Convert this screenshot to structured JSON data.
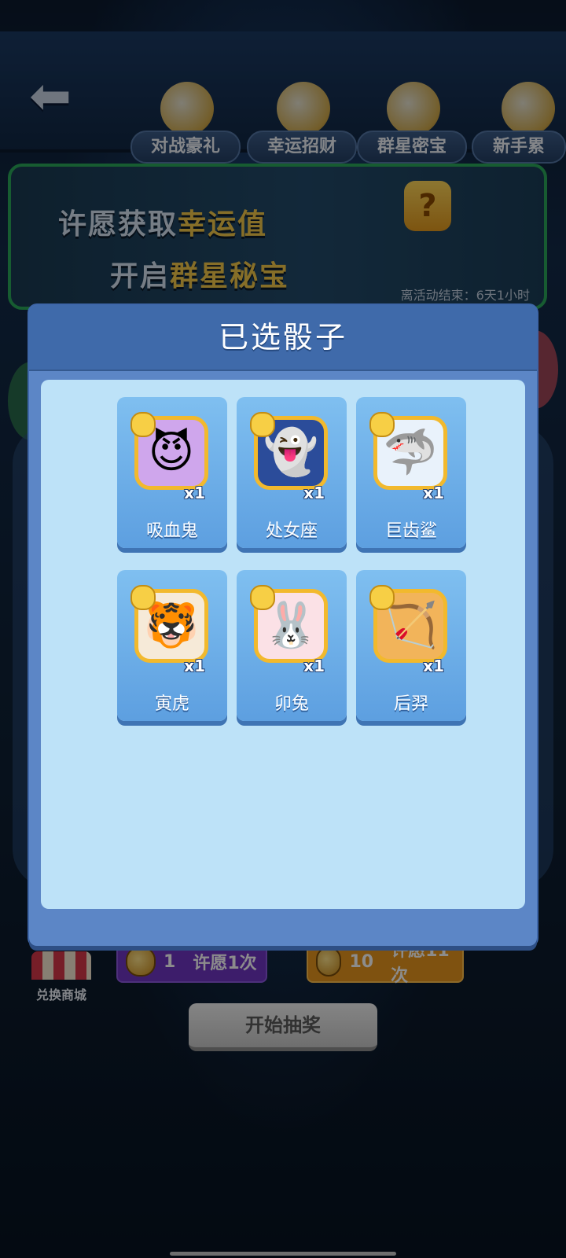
{
  "top_nav": {
    "tabs": [
      {
        "label": "对战豪礼"
      },
      {
        "label": "幸运招财"
      },
      {
        "label": "群星密宝"
      },
      {
        "label": "新手累"
      }
    ]
  },
  "banner": {
    "line1_prefix": "许愿获取",
    "line1_highlight": "幸运值",
    "line2_prefix": "开启",
    "line2_highlight": "群星秘宝",
    "timer": "离活动结束：6天1小时"
  },
  "bottom": {
    "shop_label": "兑换商城",
    "wish_once": {
      "cost": "1",
      "label": "许愿1次"
    },
    "wish_ten": {
      "cost": "10",
      "label": "许愿11次"
    },
    "start_label": "开始抽奖"
  },
  "modal": {
    "title": "已选骰子",
    "dice": [
      {
        "name": "吸血鬼",
        "count": "x1",
        "icon": "vampire-icon",
        "glyph": "😈",
        "bg": "#cfa6ec"
      },
      {
        "name": "处女座",
        "count": "x1",
        "icon": "virgo-ghost-icon",
        "glyph": "👻",
        "bg": "#2b4c9a"
      },
      {
        "name": "巨齿鲨",
        "count": "x1",
        "icon": "shark-icon",
        "glyph": "🦈",
        "bg": "#e9f2fb"
      },
      {
        "name": "寅虎",
        "count": "x1",
        "icon": "tiger-icon",
        "glyph": "🐯",
        "bg": "#f6ead8"
      },
      {
        "name": "卯兔",
        "count": "x1",
        "icon": "rabbit-icon",
        "glyph": "🐰",
        "bg": "#fbe1e6"
      },
      {
        "name": "后羿",
        "count": "x1",
        "icon": "archer-bow-icon",
        "glyph": "🏹",
        "bg": "#f2b45a"
      }
    ]
  }
}
